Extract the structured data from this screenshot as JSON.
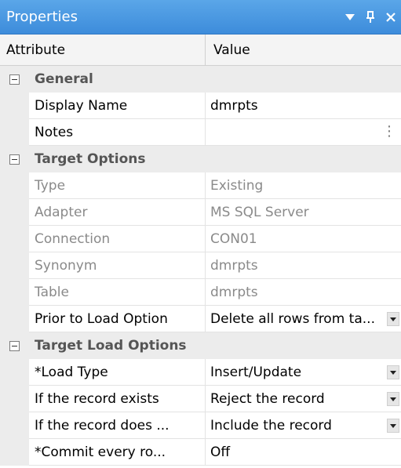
{
  "titlebar": {
    "title": "Properties",
    "dropdown_glyph": "▼",
    "pin_glyph": "ᛘ",
    "close_glyph": "✕"
  },
  "columns": {
    "attribute": "Attribute",
    "value": "Value"
  },
  "categories": [
    {
      "label": "General",
      "rows": [
        {
          "name": "Display Name",
          "value": "dmrpts",
          "readonly": false,
          "control": "none"
        },
        {
          "name": "Notes",
          "value": "",
          "readonly": false,
          "control": "ellipsis",
          "control_glyph": "⋮"
        }
      ]
    },
    {
      "label": "Target Options",
      "rows": [
        {
          "name": "Type",
          "value": "Existing",
          "readonly": true,
          "control": "none"
        },
        {
          "name": "Adapter",
          "value": "MS SQL Server",
          "readonly": true,
          "control": "none"
        },
        {
          "name": "Connection",
          "value": "CON01",
          "readonly": true,
          "control": "none"
        },
        {
          "name": "Synonym",
          "value": "dmrpts",
          "readonly": true,
          "control": "none"
        },
        {
          "name": "Table",
          "value": "dmrpts",
          "readonly": true,
          "control": "none"
        },
        {
          "name": "Prior to Load Option",
          "value": "Delete all rows from ta...",
          "readonly": false,
          "control": "dropdown"
        }
      ]
    },
    {
      "label": "Target Load Options",
      "rows": [
        {
          "name": "*Load Type",
          "value": "Insert/Update",
          "readonly": false,
          "control": "dropdown"
        },
        {
          "name": "If the record exists",
          "value": "Reject the record",
          "readonly": false,
          "control": "dropdown"
        },
        {
          "name": "If the record does ...",
          "value": "Include the record",
          "readonly": false,
          "control": "dropdown"
        },
        {
          "name": "*Commit every ro...",
          "value": "Off",
          "readonly": false,
          "control": "none"
        }
      ]
    }
  ]
}
